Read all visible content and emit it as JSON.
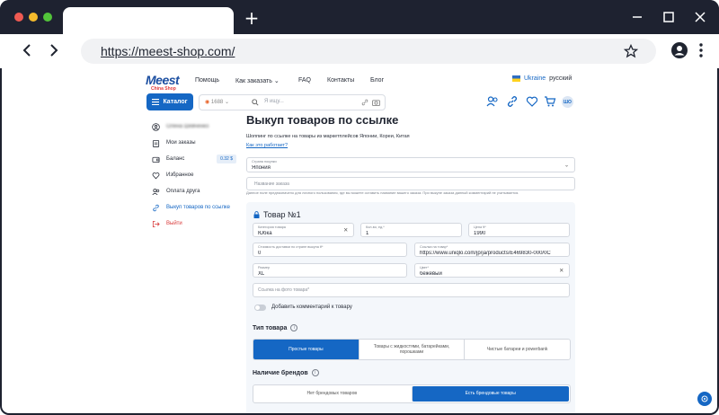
{
  "browser": {
    "url": "https://meest-shop.com/",
    "new_tab": "+"
  },
  "header": {
    "logo_main": "Meest",
    "logo_sub": "China Shop",
    "nav": [
      "Помощь",
      "Как заказать",
      "FAQ",
      "Контакты",
      "Блог"
    ],
    "lang_country": "Ukraine",
    "lang_code": "русский",
    "catalog_label": "Каталог",
    "search_select": "1688",
    "search_placeholder": "Я ищу...",
    "profile_badge": "ШО"
  },
  "sidebar": {
    "user_name": "Олена Шевченко",
    "items": [
      {
        "label": "Мои заказы",
        "icon": "clipboard-icon"
      },
      {
        "label": "Баланс",
        "icon": "wallet-icon",
        "badge": "0.32 $"
      },
      {
        "label": "Избранное",
        "icon": "heart-icon"
      },
      {
        "label": "Оплата друга",
        "icon": "users-icon"
      },
      {
        "label": "Выкуп товаров по ссылке",
        "icon": "link-icon",
        "active": true
      },
      {
        "label": "Выйти",
        "icon": "logout-icon"
      }
    ]
  },
  "main": {
    "title": "Выкуп товаров по ссылке",
    "subtitle": "Шоппинг по ссылке на товары из маркетплейсов Японии, Кореи, Китая",
    "how_link": "Как это работает?",
    "country_label": "Страна покупки",
    "country_value": "Япония",
    "order_name_placeholder": "Название заказа",
    "order_hint": "Данное поле предназначено для личного пользования, где вы можете оставить название вашего заказа. При выкупе заказа данный комментарий не учитывается.",
    "product": {
      "title": "Товар №1",
      "category_label": "Категория товара",
      "category_value": "Юбка",
      "qty_label": "Кол-во, ед.*",
      "qty_value": "1",
      "price_label": "Цена ¥*",
      "price_value": "1990",
      "delivery_label": "Стоимость доставки по стране выкупа ¥*",
      "delivery_value": "0",
      "link_label": "Ссылка на товар*",
      "link_value": "https://www.uniqlo.com/jp/ja/products/E469830-000/0C",
      "size_label": "Размер",
      "size_value": "XL",
      "color_label": "Цвет*",
      "color_value": "бежевый",
      "photo_placeholder": "Ссылка на фото товара*",
      "comment_toggle": "Добавить комментарий к товару"
    },
    "type_section": {
      "title": "Тип товара",
      "options": [
        "Простые товары",
        "Товары с жидкостями, батарейками, порошками",
        "Чистые батареи и powerbank"
      ],
      "selected": 0
    },
    "brand_section": {
      "title": "Наличие брендов",
      "options": [
        "Нет брендовых товаров",
        "Есть брендовые товары"
      ],
      "selected": 1
    }
  }
}
